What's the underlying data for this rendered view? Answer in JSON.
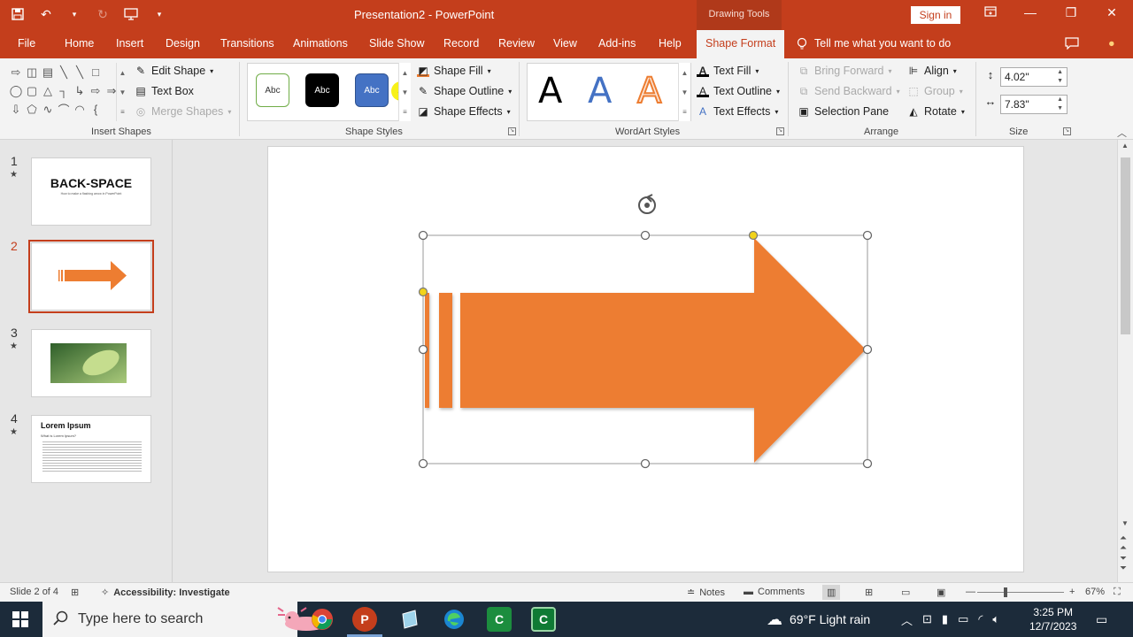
{
  "app": {
    "title": "Presentation2  -  PowerPoint",
    "contextual_tab_group": "Drawing Tools",
    "sign_in": "Sign in"
  },
  "tabs": [
    "File",
    "Home",
    "Insert",
    "Design",
    "Transitions",
    "Animations",
    "Slide Show",
    "Record",
    "Review",
    "View",
    "Add-ins",
    "Help",
    "Shape Format"
  ],
  "tell_me": "Tell me what you want to do",
  "ribbon": {
    "insert_shapes": {
      "label": "Insert Shapes",
      "edit_shape": "Edit Shape",
      "text_box": "Text Box",
      "merge_shapes": "Merge Shapes"
    },
    "shape_styles": {
      "label": "Shape Styles",
      "swatch_text": "Abc",
      "shape_fill": "Shape Fill",
      "shape_outline": "Shape Outline",
      "shape_effects": "Shape Effects"
    },
    "wordart_styles": {
      "label": "WordArt Styles",
      "sample": "A",
      "text_fill": "Text Fill",
      "text_outline": "Text Outline",
      "text_effects": "Text Effects"
    },
    "arrange": {
      "label": "Arrange",
      "bring_forward": "Bring Forward",
      "send_backward": "Send Backward",
      "selection_pane": "Selection Pane",
      "align": "Align",
      "group": "Group",
      "rotate": "Rotate"
    },
    "size": {
      "label": "Size",
      "height": "4.02\"",
      "width": "7.83\""
    }
  },
  "slides": [
    {
      "number": "1",
      "title": "BACK-SPACE",
      "subtitle": "How to make a flashing arrow in PowerPoint"
    },
    {
      "number": "2"
    },
    {
      "number": "3"
    },
    {
      "number": "4",
      "title": "Lorem Ipsum",
      "bullet": "What is Lorem Ipsum?"
    }
  ],
  "status": {
    "slide_counter": "Slide 2 of 4",
    "accessibility": "Accessibility: Investigate",
    "notes": "Notes",
    "comments": "Comments",
    "zoom": "67%"
  },
  "taskbar": {
    "search_placeholder": "Type here to search",
    "weather": "69°F  Light rain",
    "time": "3:25 PM",
    "date": "12/7/2023"
  },
  "colors": {
    "accent": "#c43e1c",
    "arrow_fill": "#ed7d31",
    "selection_handle_yellow": "#f2d31a"
  }
}
